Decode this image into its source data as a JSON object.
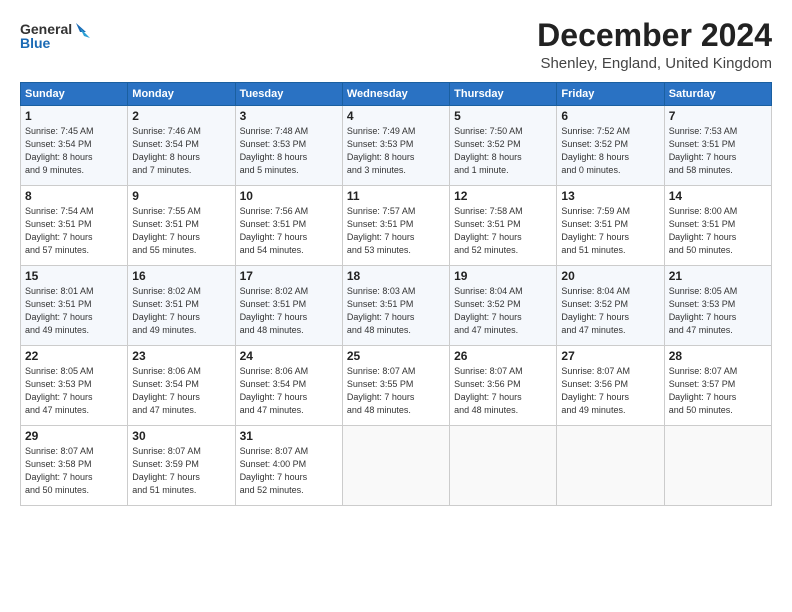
{
  "header": {
    "logo_line1": "General",
    "logo_line2": "Blue",
    "main_title": "December 2024",
    "subtitle": "Shenley, England, United Kingdom"
  },
  "calendar": {
    "columns": [
      "Sunday",
      "Monday",
      "Tuesday",
      "Wednesday",
      "Thursday",
      "Friday",
      "Saturday"
    ],
    "rows": [
      [
        {
          "day": "1",
          "info": "Sunrise: 7:45 AM\nSunset: 3:54 PM\nDaylight: 8 hours\nand 9 minutes."
        },
        {
          "day": "2",
          "info": "Sunrise: 7:46 AM\nSunset: 3:54 PM\nDaylight: 8 hours\nand 7 minutes."
        },
        {
          "day": "3",
          "info": "Sunrise: 7:48 AM\nSunset: 3:53 PM\nDaylight: 8 hours\nand 5 minutes."
        },
        {
          "day": "4",
          "info": "Sunrise: 7:49 AM\nSunset: 3:53 PM\nDaylight: 8 hours\nand 3 minutes."
        },
        {
          "day": "5",
          "info": "Sunrise: 7:50 AM\nSunset: 3:52 PM\nDaylight: 8 hours\nand 1 minute."
        },
        {
          "day": "6",
          "info": "Sunrise: 7:52 AM\nSunset: 3:52 PM\nDaylight: 8 hours\nand 0 minutes."
        },
        {
          "day": "7",
          "info": "Sunrise: 7:53 AM\nSunset: 3:51 PM\nDaylight: 7 hours\nand 58 minutes."
        }
      ],
      [
        {
          "day": "8",
          "info": "Sunrise: 7:54 AM\nSunset: 3:51 PM\nDaylight: 7 hours\nand 57 minutes."
        },
        {
          "day": "9",
          "info": "Sunrise: 7:55 AM\nSunset: 3:51 PM\nDaylight: 7 hours\nand 55 minutes."
        },
        {
          "day": "10",
          "info": "Sunrise: 7:56 AM\nSunset: 3:51 PM\nDaylight: 7 hours\nand 54 minutes."
        },
        {
          "day": "11",
          "info": "Sunrise: 7:57 AM\nSunset: 3:51 PM\nDaylight: 7 hours\nand 53 minutes."
        },
        {
          "day": "12",
          "info": "Sunrise: 7:58 AM\nSunset: 3:51 PM\nDaylight: 7 hours\nand 52 minutes."
        },
        {
          "day": "13",
          "info": "Sunrise: 7:59 AM\nSunset: 3:51 PM\nDaylight: 7 hours\nand 51 minutes."
        },
        {
          "day": "14",
          "info": "Sunrise: 8:00 AM\nSunset: 3:51 PM\nDaylight: 7 hours\nand 50 minutes."
        }
      ],
      [
        {
          "day": "15",
          "info": "Sunrise: 8:01 AM\nSunset: 3:51 PM\nDaylight: 7 hours\nand 49 minutes."
        },
        {
          "day": "16",
          "info": "Sunrise: 8:02 AM\nSunset: 3:51 PM\nDaylight: 7 hours\nand 49 minutes."
        },
        {
          "day": "17",
          "info": "Sunrise: 8:02 AM\nSunset: 3:51 PM\nDaylight: 7 hours\nand 48 minutes."
        },
        {
          "day": "18",
          "info": "Sunrise: 8:03 AM\nSunset: 3:51 PM\nDaylight: 7 hours\nand 48 minutes."
        },
        {
          "day": "19",
          "info": "Sunrise: 8:04 AM\nSunset: 3:52 PM\nDaylight: 7 hours\nand 47 minutes."
        },
        {
          "day": "20",
          "info": "Sunrise: 8:04 AM\nSunset: 3:52 PM\nDaylight: 7 hours\nand 47 minutes."
        },
        {
          "day": "21",
          "info": "Sunrise: 8:05 AM\nSunset: 3:53 PM\nDaylight: 7 hours\nand 47 minutes."
        }
      ],
      [
        {
          "day": "22",
          "info": "Sunrise: 8:05 AM\nSunset: 3:53 PM\nDaylight: 7 hours\nand 47 minutes."
        },
        {
          "day": "23",
          "info": "Sunrise: 8:06 AM\nSunset: 3:54 PM\nDaylight: 7 hours\nand 47 minutes."
        },
        {
          "day": "24",
          "info": "Sunrise: 8:06 AM\nSunset: 3:54 PM\nDaylight: 7 hours\nand 47 minutes."
        },
        {
          "day": "25",
          "info": "Sunrise: 8:07 AM\nSunset: 3:55 PM\nDaylight: 7 hours\nand 48 minutes."
        },
        {
          "day": "26",
          "info": "Sunrise: 8:07 AM\nSunset: 3:56 PM\nDaylight: 7 hours\nand 48 minutes."
        },
        {
          "day": "27",
          "info": "Sunrise: 8:07 AM\nSunset: 3:56 PM\nDaylight: 7 hours\nand 49 minutes."
        },
        {
          "day": "28",
          "info": "Sunrise: 8:07 AM\nSunset: 3:57 PM\nDaylight: 7 hours\nand 50 minutes."
        }
      ],
      [
        {
          "day": "29",
          "info": "Sunrise: 8:07 AM\nSunset: 3:58 PM\nDaylight: 7 hours\nand 50 minutes."
        },
        {
          "day": "30",
          "info": "Sunrise: 8:07 AM\nSunset: 3:59 PM\nDaylight: 7 hours\nand 51 minutes."
        },
        {
          "day": "31",
          "info": "Sunrise: 8:07 AM\nSunset: 4:00 PM\nDaylight: 7 hours\nand 52 minutes."
        },
        {
          "day": "",
          "info": ""
        },
        {
          "day": "",
          "info": ""
        },
        {
          "day": "",
          "info": ""
        },
        {
          "day": "",
          "info": ""
        }
      ]
    ]
  }
}
